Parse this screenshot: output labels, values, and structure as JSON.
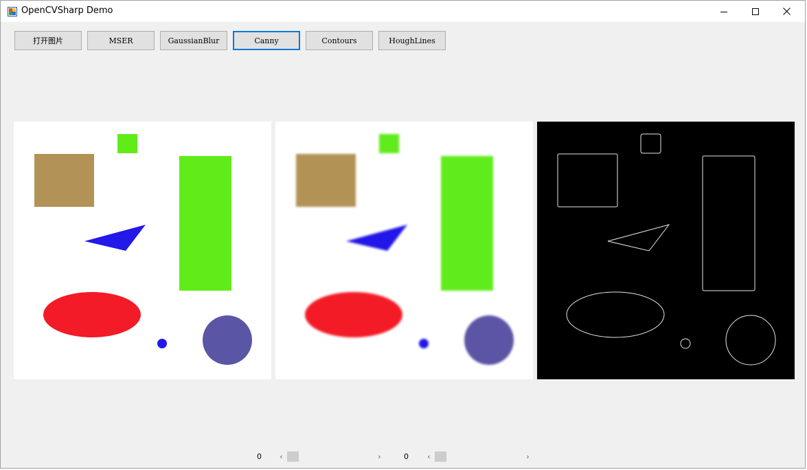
{
  "window": {
    "title": "OpenCVSharp Demo",
    "controls": [
      "minimize-icon",
      "maximize-icon",
      "close-icon"
    ]
  },
  "toolbar": {
    "buttons": [
      {
        "label": "打开图片"
      },
      {
        "label": "MSER"
      },
      {
        "label": "GaussianBlur"
      },
      {
        "label": "Canny",
        "active": true
      },
      {
        "label": "Contours"
      },
      {
        "label": "HoughLines"
      }
    ]
  },
  "panels": {
    "original": {
      "label": ""
    },
    "blurred": {
      "label": ""
    },
    "edges": {
      "label": ""
    }
  },
  "trackbars": [
    {
      "value": "0",
      "position": 0
    },
    {
      "value": "0",
      "position": 0
    }
  ],
  "colors": {
    "accent": "#0078d7",
    "tan": "#b39257",
    "green": "#61ec1a",
    "blue": "#2319e8",
    "red": "#f31b27",
    "purple": "#5b55a5"
  }
}
